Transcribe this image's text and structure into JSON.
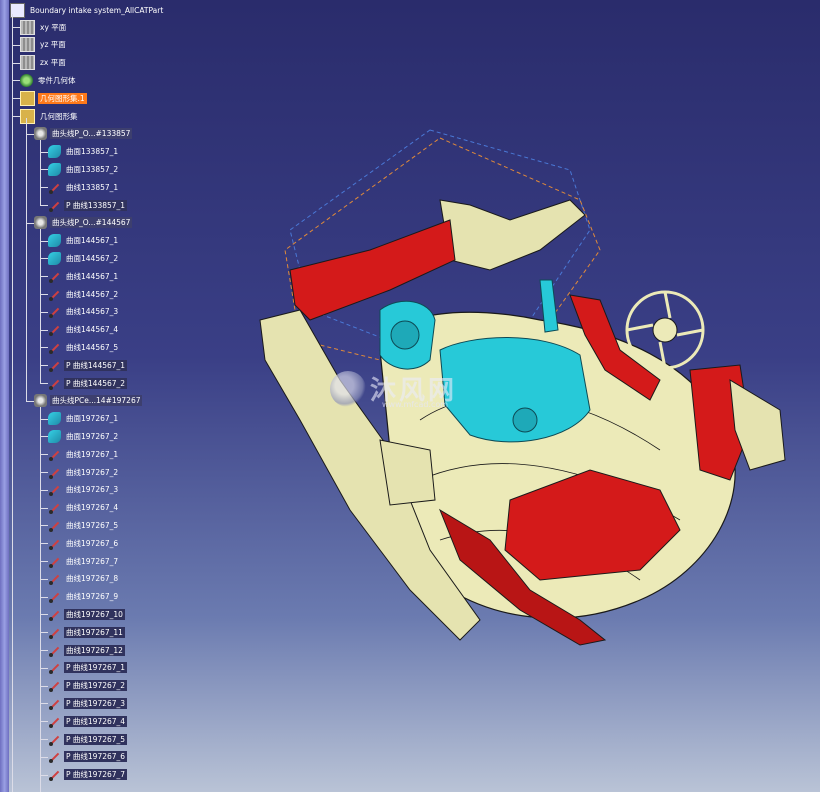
{
  "tree": {
    "root_label": "Boundary intake system_AllCATPart",
    "items": [
      {
        "label": "xy 平面",
        "icon": "plane-icon"
      },
      {
        "label": "yz 平面",
        "icon": "plane-icon"
      },
      {
        "label": "zx 平面",
        "icon": "plane-icon"
      },
      {
        "label": "零件几何体",
        "icon": "body-icon"
      },
      {
        "label": "几何图形集.1",
        "icon": "geometric-set-icon",
        "highlighted": true
      },
      {
        "label": "几何图形集",
        "icon": "geometric-set-icon"
      },
      {
        "label": "曲头线P_O...#133857",
        "icon": "feature-icon",
        "boxed": true
      },
      {
        "label": "曲面133857_1",
        "icon": "surface-icon"
      },
      {
        "label": "曲面133857_2",
        "icon": "surface-icon"
      },
      {
        "label": "曲线133857_1",
        "icon": "curve-icon"
      },
      {
        "label": "P 曲线133857_1",
        "icon": "curve-icon"
      },
      {
        "label": "曲头线P_O...#144567",
        "icon": "feature-icon",
        "boxed": true
      },
      {
        "label": "曲面144567_1",
        "icon": "surface-icon"
      },
      {
        "label": "曲面144567_2",
        "icon": "surface-icon"
      },
      {
        "label": "曲线144567_1",
        "icon": "curve-icon"
      },
      {
        "label": "曲线144567_2",
        "icon": "curve-icon"
      },
      {
        "label": "曲线144567_3",
        "icon": "curve-icon"
      },
      {
        "label": "曲线144567_4",
        "icon": "curve-icon"
      },
      {
        "label": "曲线144567_5",
        "icon": "curve-icon"
      },
      {
        "label": "P 曲线144567_1",
        "icon": "curve-icon"
      },
      {
        "label": "P 曲线144567_2",
        "icon": "curve-icon"
      },
      {
        "label": "曲头线PCe...14#197267",
        "icon": "feature-icon",
        "boxed": true
      },
      {
        "label": "曲面197267_1",
        "icon": "surface-icon"
      },
      {
        "label": "曲面197267_2",
        "icon": "surface-icon"
      },
      {
        "label": "曲线197267_1",
        "icon": "curve-icon"
      },
      {
        "label": "曲线197267_2",
        "icon": "curve-icon"
      },
      {
        "label": "曲线197267_3",
        "icon": "curve-icon"
      },
      {
        "label": "曲线197267_4",
        "icon": "curve-icon"
      },
      {
        "label": "曲线197267_5",
        "icon": "curve-icon"
      },
      {
        "label": "曲线197267_6",
        "icon": "curve-icon"
      },
      {
        "label": "曲线197267_7",
        "icon": "curve-icon"
      },
      {
        "label": "曲线197267_8",
        "icon": "curve-icon"
      },
      {
        "label": "曲线197267_9",
        "icon": "curve-icon"
      },
      {
        "label": "曲线197267_10",
        "icon": "curve-icon"
      },
      {
        "label": "曲线197267_11",
        "icon": "curve-icon"
      },
      {
        "label": "曲线197267_12",
        "icon": "curve-icon"
      },
      {
        "label": "P 曲线197267_1",
        "icon": "curve-icon"
      },
      {
        "label": "P 曲线197267_2",
        "icon": "curve-icon"
      },
      {
        "label": "P 曲线197267_3",
        "icon": "curve-icon"
      },
      {
        "label": "P 曲线197267_4",
        "icon": "curve-icon"
      },
      {
        "label": "P 曲线197267_5",
        "icon": "curve-icon"
      },
      {
        "label": "P 曲线197267_6",
        "icon": "curve-icon"
      },
      {
        "label": "P 曲线197267_7",
        "icon": "curve-icon"
      }
    ]
  },
  "watermark": {
    "text": "沐风网",
    "url": "www.mfcad.com"
  },
  "colors": {
    "background_top": "#2a2c6c",
    "background_bottom": "#b9c3d6",
    "part_red": "#d41a1a",
    "part_cream": "#eceab8",
    "part_cyan": "#27c9d8",
    "highlight": "#ff7a1a"
  }
}
